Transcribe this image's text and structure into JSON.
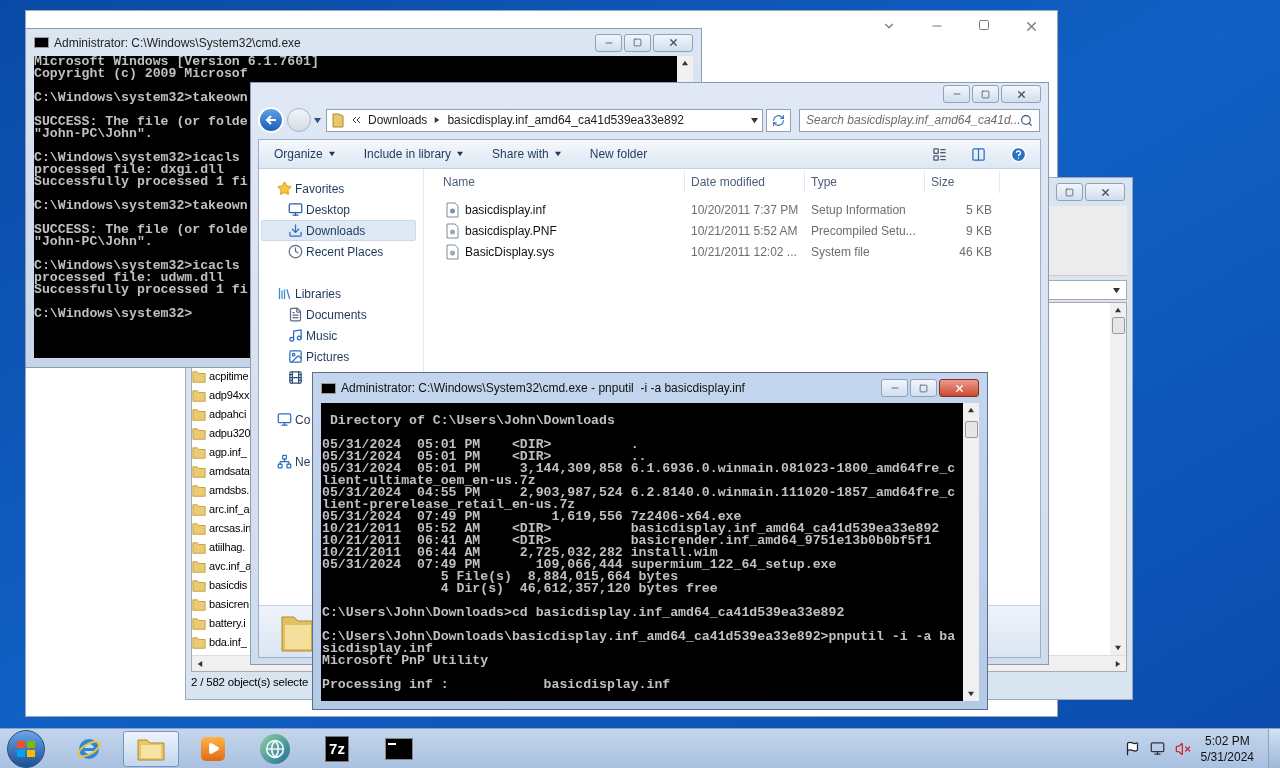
{
  "file_manager": {
    "files": [
      "acpitime",
      "adp94xx",
      "adpahci",
      "adpu320",
      "agp.inf_",
      "amdsata",
      "amdsbs.",
      "arc.inf_a",
      "arcsas.in",
      "atiilhag.",
      "avc.inf_a",
      "basicdis",
      "basicren",
      "battery.i",
      "bda.inf_"
    ],
    "status": "2 / 582 object(s) selecte"
  },
  "cmd_window": {
    "title": "Administrator: C:\\Windows\\System32\\cmd.exe",
    "blocks": [
      [
        "Microsoft Windows [Version 6.1.7601]",
        "Copyright (c) 2009 Microsof"
      ],
      [
        "C:\\Windows\\system32>takeown"
      ],
      [
        "SUCCESS: The file (or folde",
        "\"John-PC\\John\"."
      ],
      [
        "C:\\Windows\\system32>icacls",
        "processed file: dxgi.dll",
        "Successfully processed 1 fi"
      ],
      [
        "C:\\Windows\\system32>takeown"
      ],
      [
        "SUCCESS: The file (or folde",
        "\"John-PC\\John\"."
      ],
      [
        "C:\\Windows\\system32>icacls",
        "processed file: udwm.dll",
        "Successfully processed 1 fi"
      ],
      [
        "C:\\Windows\\system32>"
      ]
    ]
  },
  "explorer": {
    "breadcrumb": [
      "Downloads",
      "basicdisplay.inf_amd64_ca41d539ea33e892"
    ],
    "search": {
      "placeholder": "Search basicdisplay.inf_amd64_ca41d..."
    },
    "commands": [
      {
        "label": "Organize",
        "menu": true
      },
      {
        "label": "Include in library",
        "menu": true
      },
      {
        "label": "Share with",
        "menu": true
      },
      {
        "label": "New folder",
        "menu": false
      }
    ],
    "nav": [
      {
        "label": "Favorites",
        "kind": "favorites",
        "selected": false,
        "children": [
          {
            "label": "Desktop",
            "kind": "desktop",
            "selected": false
          },
          {
            "label": "Downloads",
            "kind": "downloads",
            "selected": true
          },
          {
            "label": "Recent Places",
            "kind": "recent",
            "selected": false
          }
        ]
      },
      {
        "label": "Libraries",
        "kind": "libraries",
        "selected": false,
        "children": [
          {
            "label": "Documents",
            "kind": "documents",
            "selected": false
          },
          {
            "label": "Music",
            "kind": "music",
            "selected": false
          },
          {
            "label": "Pictures",
            "kind": "pictures",
            "selected": false
          },
          {
            "kind": "videos",
            "selected": false
          }
        ]
      },
      {
        "label": "Co",
        "kind": "computer",
        "selected": false
      },
      {
        "label": "Ne",
        "kind": "network",
        "selected": false
      }
    ],
    "columns": [
      "Name",
      "Date modified",
      "Type",
      "Size"
    ],
    "rows": [
      {
        "name": "basicdisplay.inf",
        "kind": "inf",
        "date": "10/20/2011 7:37 PM",
        "type": "Setup Information",
        "size": "5 KB"
      },
      {
        "name": "basicdisplay.PNF",
        "kind": "pnf",
        "date": "10/21/2011 5:52 AM",
        "type": "Precompiled Setu...",
        "size": "9 KB"
      },
      {
        "name": "BasicDisplay.sys",
        "kind": "sys",
        "date": "10/21/2011 12:02 ...",
        "type": "System file",
        "size": "46 KB"
      }
    ]
  },
  "console_window": {
    "title": "Administrator: C:\\Windows\\System32\\cmd.exe - pnputil  -i -a basicdisplay.inf",
    "blocks": [
      [
        " Directory of C:\\Users\\John\\Downloads"
      ],
      [
        "05/31/2024  05:01 PM    <DIR>          .",
        "05/31/2024  05:01 PM    <DIR>          ..",
        "05/31/2024  05:01 PM     3,144,309,858 6.1.6936.0.winmain.081023-1800_amd64fre_c",
        "lient-ultimate_oem_en-us.7z",
        "05/31/2024  04:55 PM     2,903,987,524 6.2.8140.0.winmain.111020-1857_amd64fre_c",
        "lient-prerelease_retail_en-us.7z",
        "05/31/2024  07:49 PM         1,619,556 7z2406-x64.exe",
        "10/21/2011  05:52 AM    <DIR>          basicdisplay.inf_amd64_ca41d539ea33e892",
        "10/21/2011  06:41 AM    <DIR>          basicrender.inf_amd64_9751e13b0b0bf5f1",
        "10/21/2011  06:44 AM     2,725,032,282 install.wim",
        "05/31/2024  07:49 PM       109,066,444 supermium_122_64_setup.exe",
        "               5 File(s)  8,884,015,664 bytes",
        "               4 Dir(s)  46,612,357,120 bytes free"
      ],
      [
        "C:\\Users\\John\\Downloads>cd basicdisplay.inf_amd64_ca41d539ea33e892"
      ],
      [
        "C:\\Users\\John\\Downloads\\basicdisplay.inf_amd64_ca41d539ea33e892>pnputil -i -a ba",
        "sicdisplay.inf",
        "Microsoft PnP Utility"
      ],
      [
        "Processing inf :            basicdisplay.inf"
      ]
    ]
  },
  "taskbar": {
    "apps": [
      {
        "kind": "ie",
        "selected": false
      },
      {
        "kind": "explorer",
        "selected": true
      },
      {
        "kind": "media",
        "selected": false
      },
      {
        "kind": "browser",
        "selected": false
      },
      {
        "kind": "archiver",
        "label": "7z",
        "selected": false
      },
      {
        "kind": "console",
        "selected": false
      }
    ],
    "time": "5:02 PM",
    "date": "5/31/2024"
  }
}
